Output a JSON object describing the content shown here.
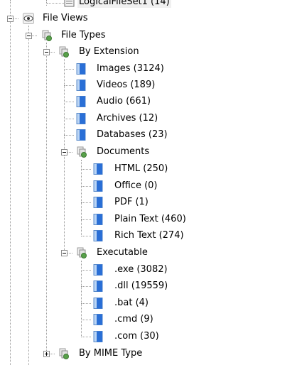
{
  "tree": {
    "logical_file_set": {
      "label": "LogicalFileSet1 (14)"
    },
    "file_views": {
      "label": "File Views"
    },
    "file_types": {
      "label": "File Types"
    },
    "by_extension": {
      "label": "By Extension"
    },
    "ext_items": [
      {
        "label": "Images (3124)"
      },
      {
        "label": "Videos (189)"
      },
      {
        "label": "Audio (661)"
      },
      {
        "label": "Archives (12)"
      },
      {
        "label": "Databases (23)"
      }
    ],
    "documents": {
      "label": "Documents"
    },
    "doc_items": [
      {
        "label": "HTML (250)"
      },
      {
        "label": "Office (0)"
      },
      {
        "label": "PDF (1)"
      },
      {
        "label": "Plain Text (460)"
      },
      {
        "label": "Rich Text (274)"
      }
    ],
    "executable": {
      "label": "Executable"
    },
    "exe_items": [
      {
        "label": ".exe (3082)"
      },
      {
        "label": ".dll (19559)"
      },
      {
        "label": ".bat (4)"
      },
      {
        "label": ".cmd (9)"
      },
      {
        "label": ".com (30)"
      }
    ],
    "by_mime_type": {
      "label": "By MIME Type"
    }
  },
  "icons": {
    "logical_file_set": "document-list-icon",
    "file_views": "eye-icon",
    "file_types": "file-types-node-icon",
    "leaf": "blue-file-icon"
  },
  "colors": {
    "leaf_icon_blue": "#2a6fd6",
    "leaf_icon_light": "#bcd6f5",
    "node_icon_green": "#58a14a"
  }
}
